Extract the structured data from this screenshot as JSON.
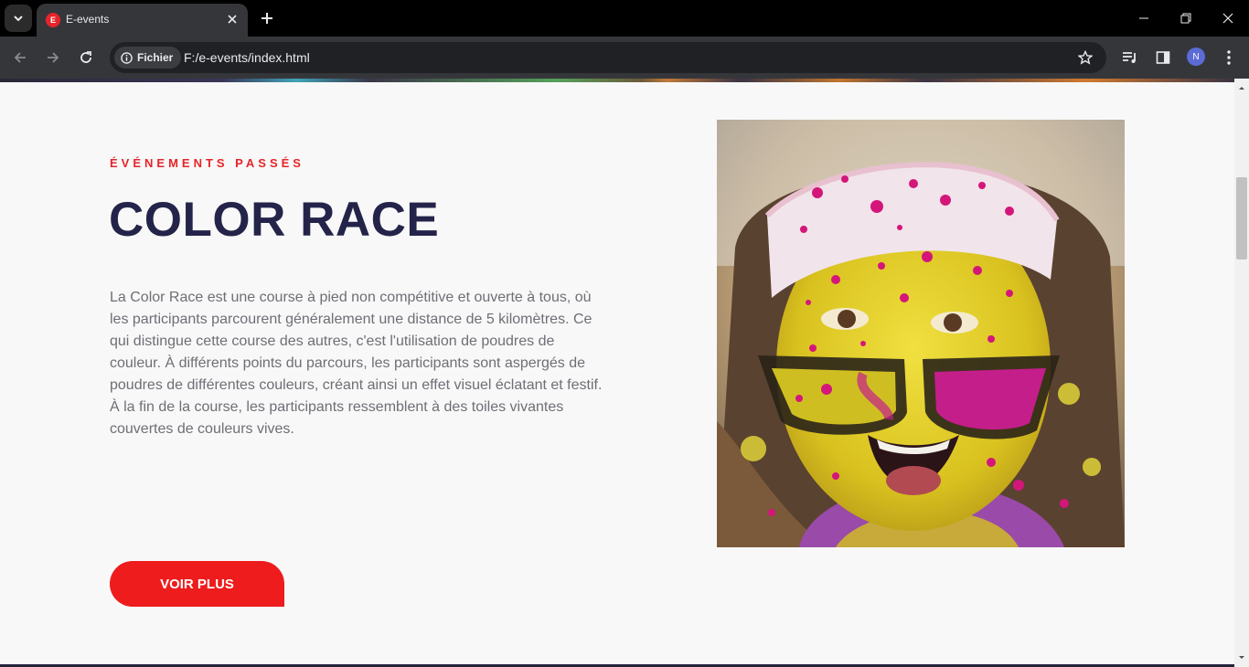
{
  "browser": {
    "tab_title": "E-events",
    "favicon_letter": "E",
    "address_chip": "Fichier",
    "url": "F:/e-events/index.html",
    "profile_initial": "N"
  },
  "section": {
    "eyebrow": "ÉVÉNEMENTS PASSÉS",
    "title": "COLOR RACE",
    "description": "La Color Race est une course à pied non compétitive et ouverte à tous, où les participants parcourent généralement une distance de 5 kilomètres. Ce qui distingue cette course des autres, c'est l'utilisation de poudres de couleur. À différents points du parcours, les participants sont aspergés de poudres de différentes couleurs, créant ainsi un effet visuel éclatant et festif. À la fin de la course, les participants ressemblent à des toiles vivantes couvertes de couleurs vives.",
    "button_label": "VOIR PLUS"
  },
  "colors": {
    "accent": "#ee1c1c",
    "title": "#24244a",
    "body_text": "#6e6e76",
    "background": "#f8f8f8"
  }
}
